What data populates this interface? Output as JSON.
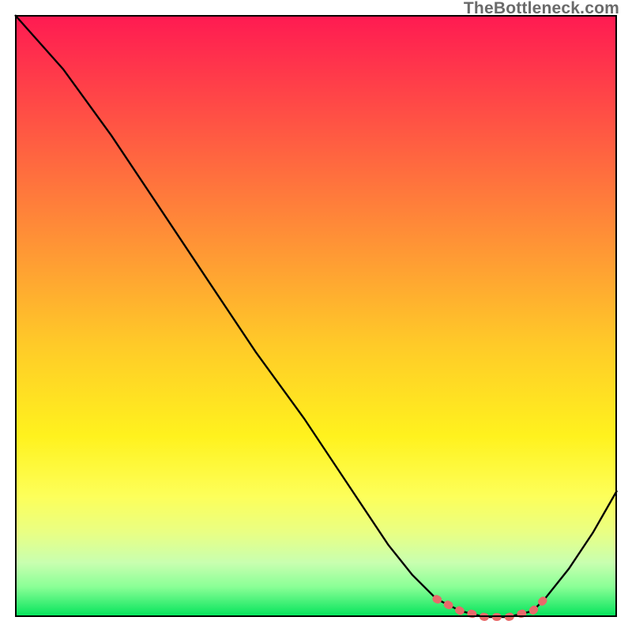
{
  "watermark": "TheBottleneck.com",
  "colors": {
    "curve_main": "#000000",
    "curve_highlight": "#e86a6a",
    "frame": "#000000"
  },
  "chart_data": {
    "type": "line",
    "title": "",
    "xlabel": "",
    "ylabel": "",
    "xlim": [
      0,
      100
    ],
    "ylim": [
      0,
      100
    ],
    "x": [
      0,
      8,
      16,
      24,
      32,
      40,
      48,
      56,
      62,
      66,
      70,
      74,
      78,
      82,
      86,
      88,
      92,
      96,
      100
    ],
    "values": [
      100,
      91,
      80,
      68,
      56,
      44,
      33,
      21,
      12,
      7,
      3,
      1,
      0,
      0,
      1,
      3,
      8,
      14,
      21
    ],
    "highlight_range_x": [
      68,
      88
    ],
    "grid": false
  }
}
